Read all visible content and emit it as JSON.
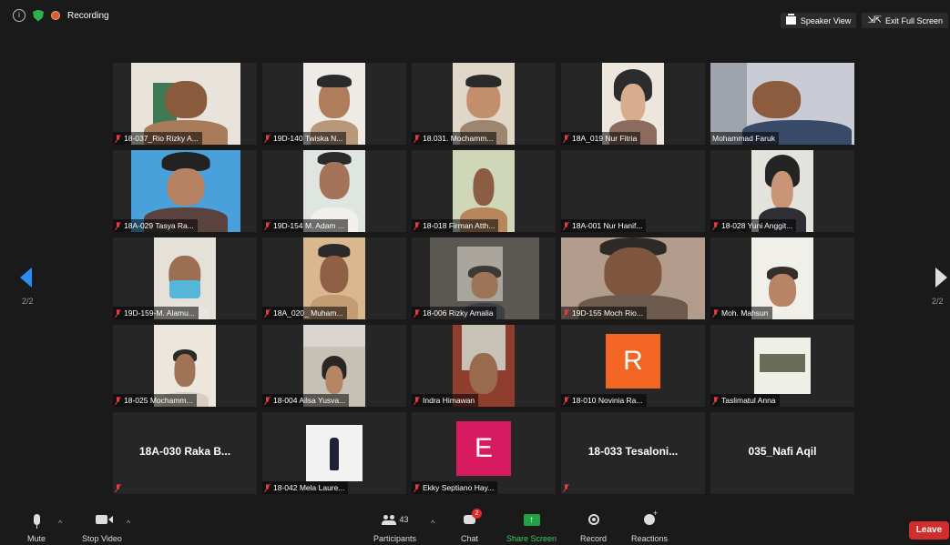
{
  "topbar": {
    "recording_label": "Recording",
    "speaker_view_label": "Speaker View",
    "exit_full_screen_label": "Exit Full Screen"
  },
  "pagination": {
    "left_label": "2/2",
    "right_label": "2/2"
  },
  "participants": [
    {
      "name": "18-037_Rio Rizky A...",
      "muted": true
    },
    {
      "name": "19D-140 Twiska N...",
      "muted": true
    },
    {
      "name": "18.031. Mochamm...",
      "muted": true
    },
    {
      "name": "18A_019 Nur Fitria",
      "muted": true
    },
    {
      "name": "Mohammad Faruk",
      "muted": false
    },
    {
      "name": "18A-029 Tasya Ra...",
      "muted": true
    },
    {
      "name": "19D-154 M. Adam ...",
      "muted": true
    },
    {
      "name": "18-018 Firman Atth...",
      "muted": true
    },
    {
      "name": "18A-001 Nur Hanif...",
      "muted": true
    },
    {
      "name": "18-028 Yuni Anggit...",
      "muted": true
    },
    {
      "name": "19D-159-M. Alamu...",
      "muted": true
    },
    {
      "name": "18A_020_ Muham...",
      "muted": true
    },
    {
      "name": "18-006 Rizky Amalia",
      "muted": true
    },
    {
      "name": "19D-155 Moch Rio...",
      "muted": true
    },
    {
      "name": "Moh. Mahsun",
      "muted": true
    },
    {
      "name": "18-025 Mochamm...",
      "muted": true
    },
    {
      "name": "18-004 Ailsa Yusva...",
      "muted": true
    },
    {
      "name": "Indra Himawan",
      "muted": true
    },
    {
      "name": "18-010 Novinia Ra...",
      "muted": true
    },
    {
      "name": "Taslimatul Anna",
      "muted": true
    },
    {
      "name": "",
      "muted": true
    },
    {
      "name": "18-042 Mela Laure...",
      "muted": true
    },
    {
      "name": "Ekky Septiano Hay...",
      "muted": true
    },
    {
      "name": "",
      "muted": true
    },
    {
      "name": "",
      "muted": false
    }
  ],
  "video_off_names": [
    "18A-030 Raka B...",
    "18-033 Tesaloni...",
    "035_Nafi Aqil"
  ],
  "avatars": [
    {
      "letter": "R",
      "color": "#f26522"
    },
    {
      "letter": "E",
      "color": "#d81b60"
    }
  ],
  "toolbar": {
    "mute_label": "Mute",
    "stop_video_label": "Stop Video",
    "participants_label": "Participants",
    "participants_count": "43",
    "chat_label": "Chat",
    "chat_badge": "2",
    "share_screen_label": "Share Screen",
    "record_label": "Record",
    "reactions_label": "Reactions",
    "leave_label": "Leave"
  },
  "colors": {
    "background": "#1a1a1a",
    "tile_background": "#262626",
    "active_arrow": "#2b8cf2",
    "share_screen_accent": "#22a244",
    "leave_button": "#d12d2d",
    "muted_icon": "#e23b3b",
    "recording_dot": "#e05a2a",
    "secure_shield": "#2db14a"
  },
  "icons": {
    "info": "info-icon",
    "shield": "shield-icon",
    "recording": "recording-dot-icon",
    "speaker_view": "speaker-view-icon",
    "exit_full_screen": "exit-fullscreen-icon",
    "muted": "mic-muted-icon",
    "mic": "mic-icon",
    "video": "camera-icon",
    "participants": "people-icon",
    "chat": "chat-icon",
    "share": "share-screen-icon",
    "record": "record-icon",
    "reactions": "reactions-icon",
    "prev_page": "arrow-left-icon",
    "next_page": "arrow-right-icon"
  }
}
